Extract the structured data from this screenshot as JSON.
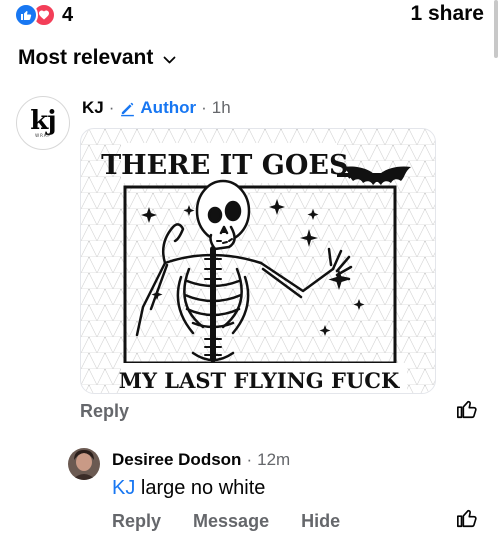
{
  "reactions": {
    "count": "4",
    "types": [
      "like-icon",
      "love-icon"
    ]
  },
  "share_count": "1 share",
  "sort": {
    "label": "Most relevant"
  },
  "comment": {
    "author": "KJ",
    "author_badge": "Author",
    "time": "1h",
    "image": {
      "top_text": "THERE IT GOES,",
      "bottom_text": "MY LAST FLYING FUCK"
    },
    "reply_label": "Reply"
  },
  "reply": {
    "author": "Desiree Dodson",
    "time": "12m",
    "mention": "KJ",
    "text": " large no white",
    "actions": {
      "reply": "Reply",
      "message": "Message",
      "hide": "Hide"
    }
  },
  "colors": {
    "accent": "#1877f2",
    "love": "#f33e58",
    "muted": "#65676b"
  }
}
